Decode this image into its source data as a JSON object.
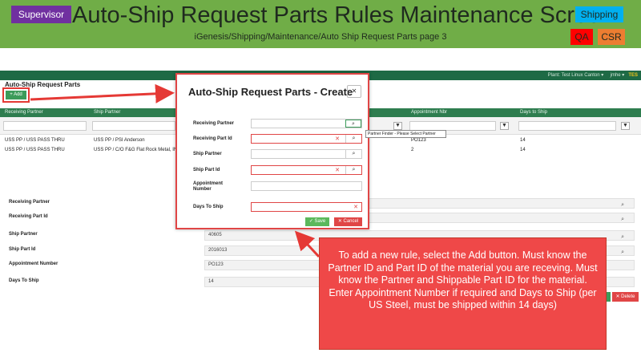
{
  "slide": {
    "supervisor_badge": "Supervisor",
    "title": "Auto-Ship Request Parts Rules Maintenance Screen",
    "subtitle": "iGenesis/Shipping/Maintenance/Auto Ship Request Parts page 3",
    "tags": {
      "shipping": "Shipping",
      "qa": "QA",
      "csr": "CSR"
    },
    "colors": {
      "header_green": "#70ad47",
      "supervisor_purple": "#7030a0",
      "shipping_blue": "#00b0f0",
      "qa_red": "#ff0000",
      "csr_orange": "#ed7d31",
      "callout_red": "#ef4848"
    }
  },
  "app": {
    "top_bar": {
      "plant": "Plant: Test Linux Canton ▾",
      "user": "jmhe ▾",
      "env": "TES"
    },
    "section_title": "Auto-Ship Request Parts",
    "add_button": "+ Add",
    "grid": {
      "columns": [
        "Receiving Partner",
        "Ship Partner",
        "Appointment Nbr",
        "Days to Ship"
      ],
      "rows": [
        {
          "receiving_partner": "USS PP / USS PASS THRU",
          "ship_partner": "USS PP / PSI Anderson",
          "appointment": "PO123",
          "days": "14"
        },
        {
          "receiving_partner": "USS PP / USS PASS THRU",
          "ship_partner": "USS PP / C/O F&G Flat Rock Metal, IN",
          "appointment": "2",
          "days": "14"
        }
      ]
    },
    "detail_form": [
      {
        "label": "Receiving Partner",
        "value": ""
      },
      {
        "label": "Receiving Part Id",
        "value": ""
      },
      {
        "label": "Ship Partner",
        "value": "40605"
      },
      {
        "label": "Ship Part Id",
        "value": "2016013"
      },
      {
        "label": "Appointment Number",
        "value": "PO123"
      },
      {
        "label": "Days To Ship",
        "value": "14"
      }
    ],
    "delete_button": "✕ Delete"
  },
  "dialog": {
    "title": "Auto-Ship Request Parts - Create",
    "close": "✕",
    "fields": [
      {
        "label": "Receiving Partner"
      },
      {
        "label": "Receiving Part Id"
      },
      {
        "label": "Ship Partner"
      },
      {
        "label": "Ship Part Id"
      },
      {
        "label": "Appointment Number"
      },
      {
        "label": "Days To Ship"
      }
    ],
    "save_button": "✓ Save",
    "cancel_button": "✕ Cancel",
    "tooltip": "Partner Finder - Please Select Partner"
  },
  "callout": {
    "text": "To add a new rule, select the Add button. Must know the Partner ID and Part ID of the material you are receving. Must know the Partner and Shippable Part ID for the material. Enter Appointment Number if required and Days to Ship (per US Steel, must be shipped within 14 days)"
  }
}
